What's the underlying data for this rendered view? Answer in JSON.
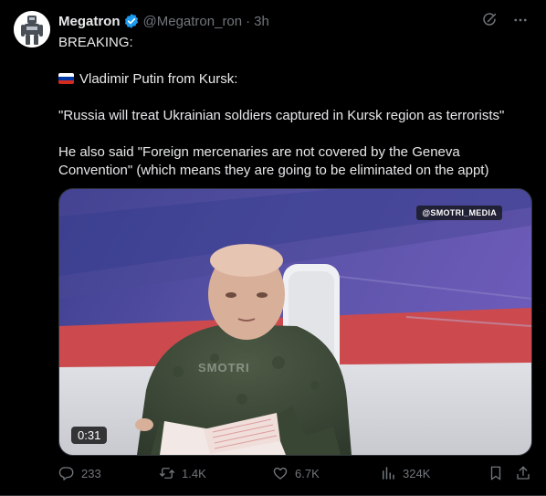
{
  "post": {
    "author_name": "Megatron",
    "handle": "@Megatron_ron",
    "separator": "·",
    "time": "3h",
    "lines": {
      "breaking": "BREAKING:",
      "putin": "Vladimir Putin from Kursk:",
      "quote": "\"Russia will treat Ukrainian soldiers captured in Kursk region as terrorists\"",
      "said_1": "He also said \"Foreign mercenaries are not covered by the Geneva",
      "said_2": "Convention\" (which means they are going to be eliminated on the appt)"
    },
    "flag": "russia-flag"
  },
  "media": {
    "watermark_tag": "@SMOTRI_MEDIA",
    "ghost_watermark": "SMOTRI",
    "duration": "0:31"
  },
  "actions": {
    "replies": "233",
    "reposts": "1.4K",
    "likes": "6.7K",
    "views": "324K"
  },
  "icons": {
    "verified": "verified-badge-icon",
    "grok": "grok-icon",
    "more": "more-icon",
    "reply": "reply-icon",
    "repost": "repost-icon",
    "like": "heart-icon",
    "views": "views-icon",
    "bookmark": "bookmark-icon",
    "share": "share-icon"
  },
  "colors": {
    "background": "#000000",
    "text": "#e7e9ea",
    "muted": "#71767b",
    "verified": "#1d9bf0",
    "border": "#2f3336"
  }
}
